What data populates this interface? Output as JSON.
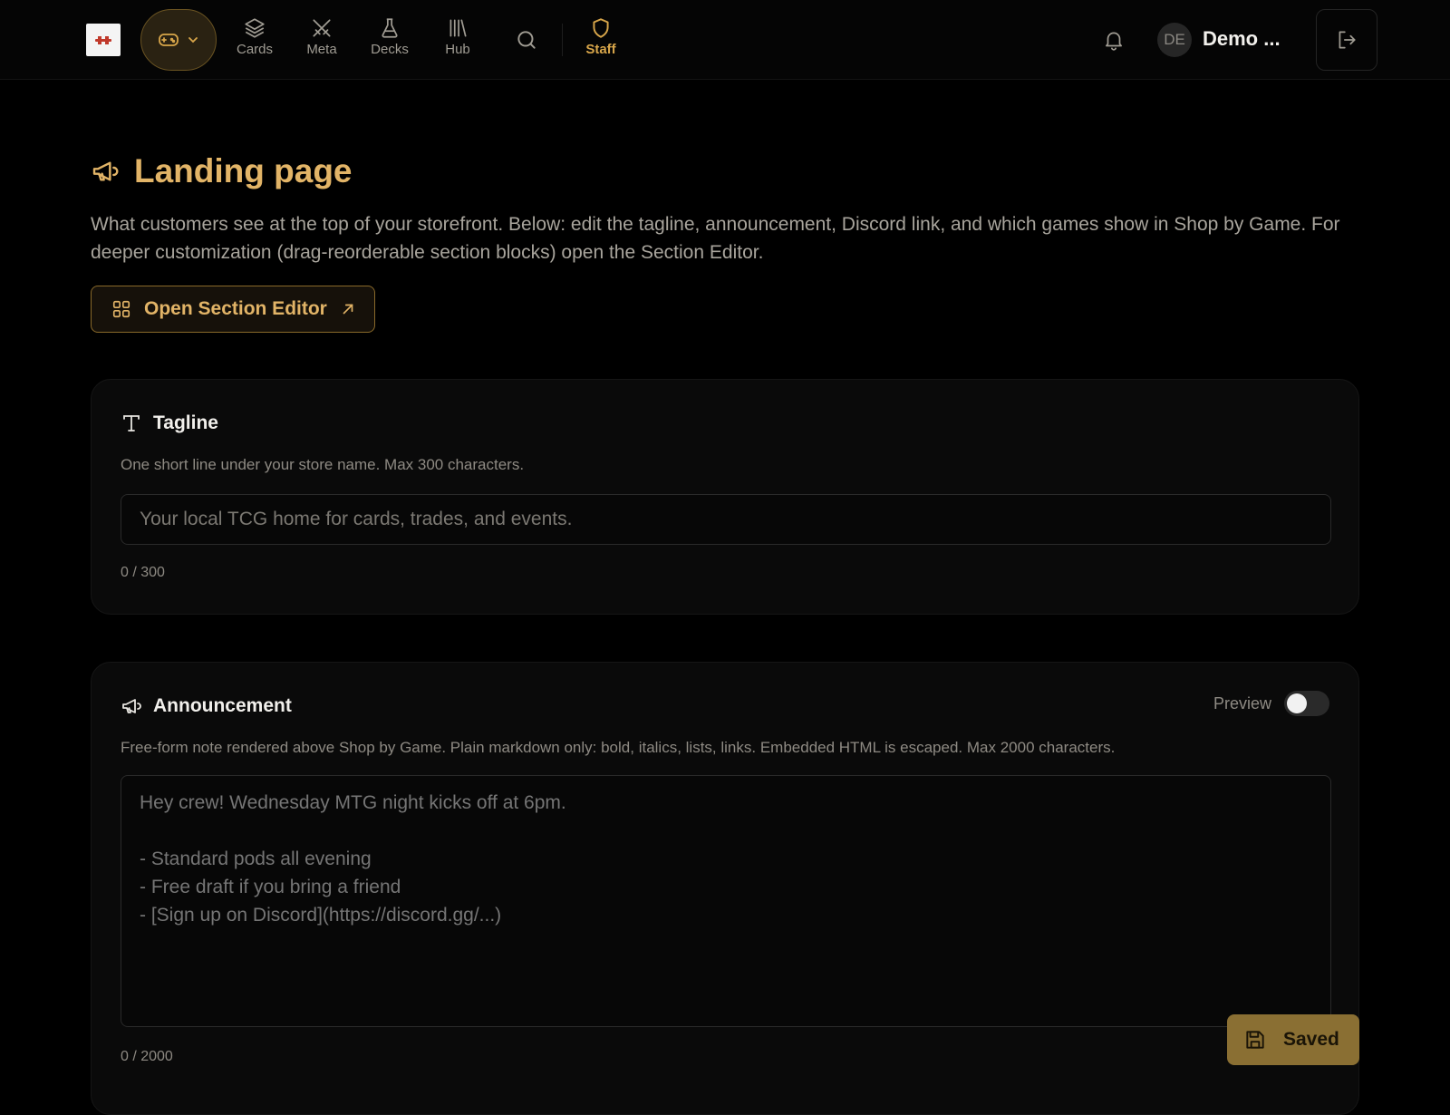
{
  "nav": {
    "items": [
      {
        "label": "Cards",
        "icon": "layers-icon"
      },
      {
        "label": "Meta",
        "icon": "crossed-swords-icon"
      },
      {
        "label": "Decks",
        "icon": "flask-icon"
      },
      {
        "label": "Hub",
        "icon": "library-icon"
      }
    ],
    "staff_label": "Staff",
    "user": {
      "initials": "DE",
      "name": "Demo ..."
    },
    "accent": "#d8a64a"
  },
  "page": {
    "title": "Landing page",
    "description": "What customers see at the top of your storefront. Below: edit the tagline, announcement, Discord link, and which games show in Shop by Game. For deeper customization (drag-reorderable section blocks) open the Section Editor.",
    "open_editor_label": "Open Section Editor"
  },
  "tagline": {
    "title": "Tagline",
    "description": "One short line under your store name. Max 300 characters.",
    "placeholder": "Your local TCG home for cards, trades, and events.",
    "value": "",
    "counter": "0 / 300"
  },
  "announcement": {
    "title": "Announcement",
    "preview_label": "Preview",
    "preview_on": false,
    "description": "Free-form note rendered above Shop by Game. Plain markdown only: bold, italics, lists, links. Embedded HTML is escaped. Max 2000 characters.",
    "placeholder": "Hey crew! Wednesday MTG night kicks off at 6pm.\n\n- Standard pods all evening\n- Free draft if you bring a friend\n- [Sign up on Discord](https://discord.gg/...)",
    "counter": "0 / 2000"
  },
  "save": {
    "label": "Saved"
  },
  "colors": {
    "gold": "#e2b467",
    "background": "#000000",
    "saved_button": "#8a6f33"
  }
}
